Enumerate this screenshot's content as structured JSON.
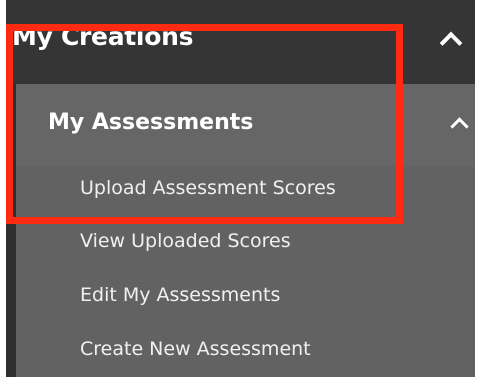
{
  "menu": {
    "title": "My Creations",
    "submenu": {
      "title": "My Assessments",
      "items": [
        {
          "label": "Upload Assessment Scores"
        },
        {
          "label": "View Uploaded Scores"
        },
        {
          "label": "Edit My Assessments"
        },
        {
          "label": "Create New Assessment"
        }
      ]
    }
  },
  "icons": {
    "header_toggle": "chevron-up-icon",
    "submenu_toggle": "chevron-up-icon"
  },
  "colors": {
    "header_bg": "#353535",
    "submenu_bg": "#626262",
    "highlight": "#ff2a12",
    "text": "#ffffff"
  }
}
